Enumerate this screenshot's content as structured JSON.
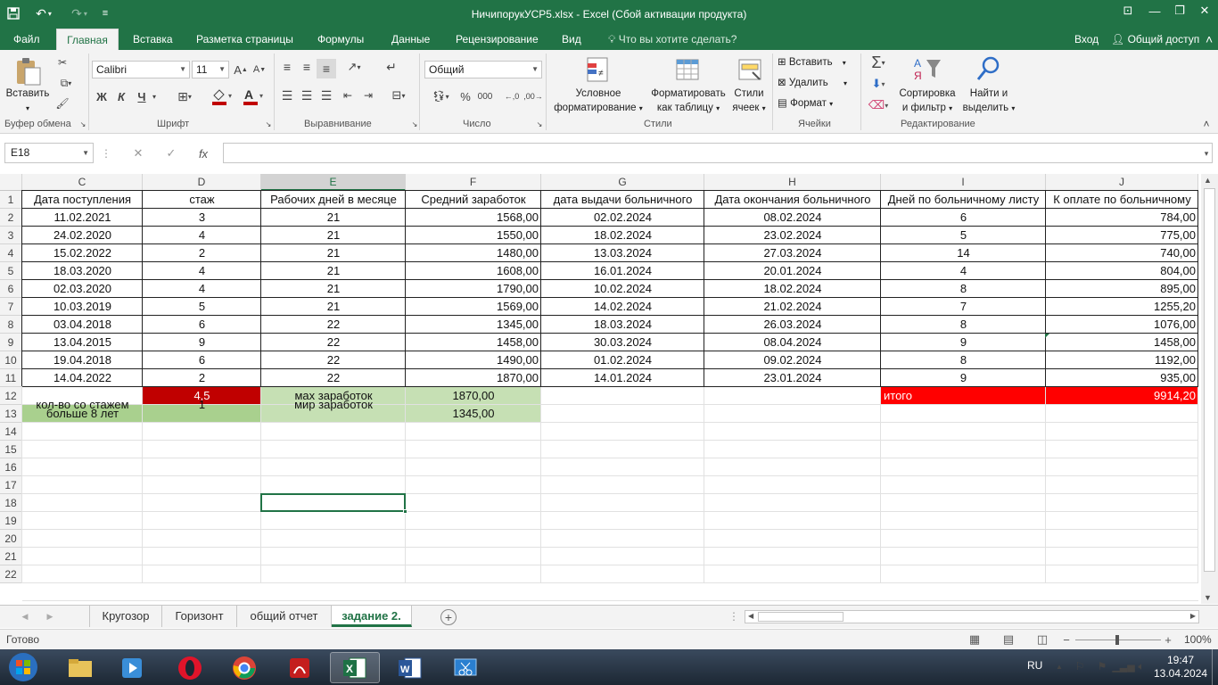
{
  "window": {
    "title": "НичипорукУСР5.xlsx - Excel (Сбой активации продукта)"
  },
  "tabs": [
    "Файл",
    "Главная",
    "Вставка",
    "Разметка страницы",
    "Формулы",
    "Данные",
    "Рецензирование",
    "Вид"
  ],
  "tell_me": "Что вы хотите сделать?",
  "signin": "Вход",
  "share": "Общий доступ",
  "ribbon": {
    "clipboard": {
      "paste": "Вставить",
      "label": "Буфер обмена"
    },
    "font": {
      "name": "Calibri",
      "size": "11",
      "label": "Шрифт",
      "bold": "Ж",
      "italic": "К",
      "underline": "Ч",
      "font_color": "#c00000"
    },
    "alignment": {
      "label": "Выравнивание"
    },
    "number": {
      "format": "Общий",
      "label": "Число"
    },
    "styles": {
      "conditional_1": "Условное",
      "conditional_2": "форматирование",
      "table_1": "Форматировать",
      "table_2": "как таблицу",
      "cell_1": "Стили",
      "cell_2": "ячеек",
      "label": "Стили"
    },
    "cells": {
      "insert": "Вставить",
      "delete": "Удалить",
      "format": "Формат",
      "label": "Ячейки"
    },
    "editing": {
      "sort_1": "Сортировка",
      "sort_2": "и фильтр",
      "find_1": "Найти и",
      "find_2": "выделить",
      "label": "Редактирование"
    }
  },
  "formula_bar": {
    "namebox": "E18",
    "formula": ""
  },
  "columns": [
    "C",
    "D",
    "E",
    "F",
    "G",
    "H",
    "I",
    "J"
  ],
  "rows_numbers": [
    "1",
    "2",
    "3",
    "4",
    "5",
    "6",
    "7",
    "8",
    "9",
    "10",
    "11",
    "12",
    "13",
    "14",
    "15",
    "16",
    "17",
    "18",
    "19",
    "20",
    "21",
    "22"
  ],
  "header_row": [
    "Дата поступления",
    "стаж",
    "Рабочих дней в месяце",
    "Средний заработок",
    "дата выдачи больничного",
    "Дата окончания больничного",
    "Дней по больничному листу",
    "К оплате по больничному"
  ],
  "data_rows": [
    [
      "11.02.2021",
      "3",
      "21",
      "1568,00",
      "02.02.2024",
      "08.02.2024",
      "6",
      "784,00"
    ],
    [
      "24.02.2020",
      "4",
      "21",
      "1550,00",
      "18.02.2024",
      "23.02.2024",
      "5",
      "775,00"
    ],
    [
      "15.02.2022",
      "2",
      "21",
      "1480,00",
      "13.03.2024",
      "27.03.2024",
      "14",
      "740,00"
    ],
    [
      "18.03.2020",
      "4",
      "21",
      "1608,00",
      "16.01.2024",
      "20.01.2024",
      "4",
      "804,00"
    ],
    [
      "02.03.2020",
      "4",
      "21",
      "1790,00",
      "10.02.2024",
      "18.02.2024",
      "8",
      "895,00"
    ],
    [
      "10.03.2019",
      "5",
      "21",
      "1569,00",
      "14.02.2024",
      "21.02.2024",
      "7",
      "1255,20"
    ],
    [
      "03.04.2018",
      "6",
      "22",
      "1345,00",
      "18.03.2024",
      "26.03.2024",
      "8",
      "1076,00"
    ],
    [
      "13.04.2015",
      "9",
      "22",
      "1458,00",
      "30.03.2024",
      "08.04.2024",
      "9",
      "1458,00"
    ],
    [
      "19.04.2018",
      "6",
      "22",
      "1490,00",
      "01.02.2024",
      "09.02.2024",
      "8",
      "1192,00"
    ],
    [
      "14.04.2022",
      "2",
      "22",
      "1870,00",
      "14.01.2024",
      "23.01.2024",
      "9",
      "935,00"
    ]
  ],
  "summary": {
    "avg_stazh": "4,5",
    "max_label": "мах заработок",
    "max_value": "1870,00",
    "itogo_label": "итого",
    "itogo_value": "9914,20",
    "count_label_1": "кол-во со стажем",
    "count_label_2": "больше 8 лет",
    "count_value": "1",
    "min_label": "мир заработок",
    "min_value": "1345,00"
  },
  "colors": {
    "excel_green": "#217346",
    "dark_red": "#c00000",
    "red": "#ff0000",
    "green_fill": "#a9d08e",
    "light_green_fill": "#c6e0b4"
  },
  "sheets": [
    "Кругозор",
    "Горизонт",
    "общий отчет",
    "задание 2."
  ],
  "active_sheet": 3,
  "status": {
    "ready": "Готово",
    "zoom": "100%"
  },
  "taskbar": {
    "lang": "RU",
    "time": "19:47",
    "date": "13.04.2024"
  }
}
